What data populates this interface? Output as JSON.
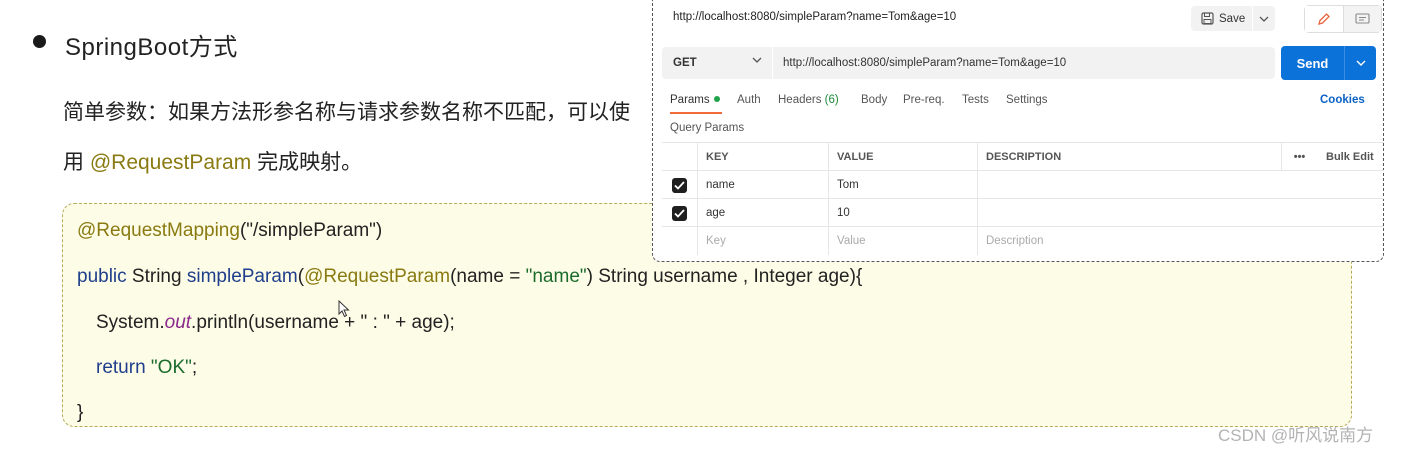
{
  "slide": {
    "heading": "SpringBoot方式",
    "desc_prefix": "简单参数：如果方法形参名称与请求参数名称不匹配，可以使用 ",
    "desc_highlight": "@RequestParam",
    "desc_suffix": " 完成映射。"
  },
  "code": {
    "line1_annotation": "@RequestMapping",
    "line1_rest": "(\"/simpleParam\")",
    "line2_public": "public",
    "line2_type": " String ",
    "line2_method": "simpleParam",
    "line2_paren": "(",
    "line2_param_ann": "@RequestParam",
    "line2_param_open": "(name = ",
    "line2_param_value": "\"name\"",
    "line2_param_rest": ") String username , Integer age){",
    "line3_prefix": "System.",
    "line3_out": "out",
    "line3_rest": ".println(username + \" : \" + age);",
    "line4_return": "return",
    "line4_value": " \"OK\"",
    "line4_semi": ";",
    "line5": "}"
  },
  "postman": {
    "title_url": "http://localhost:8080/simpleParam?name=Tom&age=10",
    "save_label": "Save",
    "method": "GET",
    "url": "http://localhost:8080/simpleParam?name=Tom&age=10",
    "send_label": "Send",
    "tabs": [
      {
        "label": "Params"
      },
      {
        "label": "Auth"
      },
      {
        "label": "Headers",
        "count": "(6)"
      },
      {
        "label": "Body"
      },
      {
        "label": "Pre-req."
      },
      {
        "label": "Tests"
      },
      {
        "label": "Settings"
      }
    ],
    "cookies_label": "Cookies",
    "query_params_label": "Query Params",
    "table": {
      "headers": {
        "key": "KEY",
        "value": "VALUE",
        "description": "DESCRIPTION",
        "more": "•••",
        "bulk_edit": "Bulk Edit"
      },
      "rows": [
        {
          "key": "name",
          "value": "Tom",
          "description": "",
          "checked": true
        },
        {
          "key": "age",
          "value": "10",
          "description": "",
          "checked": true
        }
      ],
      "placeholder": {
        "key": "Key",
        "value": "Value",
        "description": "Description"
      }
    }
  },
  "watermark": "CSDN @听风说南方",
  "colors": {
    "send": "#0a72d8",
    "annotation": "#8a7a12",
    "keyword": "#1f3f8c",
    "string": "#1b6b2d",
    "active_tab": "#f26b3a"
  }
}
